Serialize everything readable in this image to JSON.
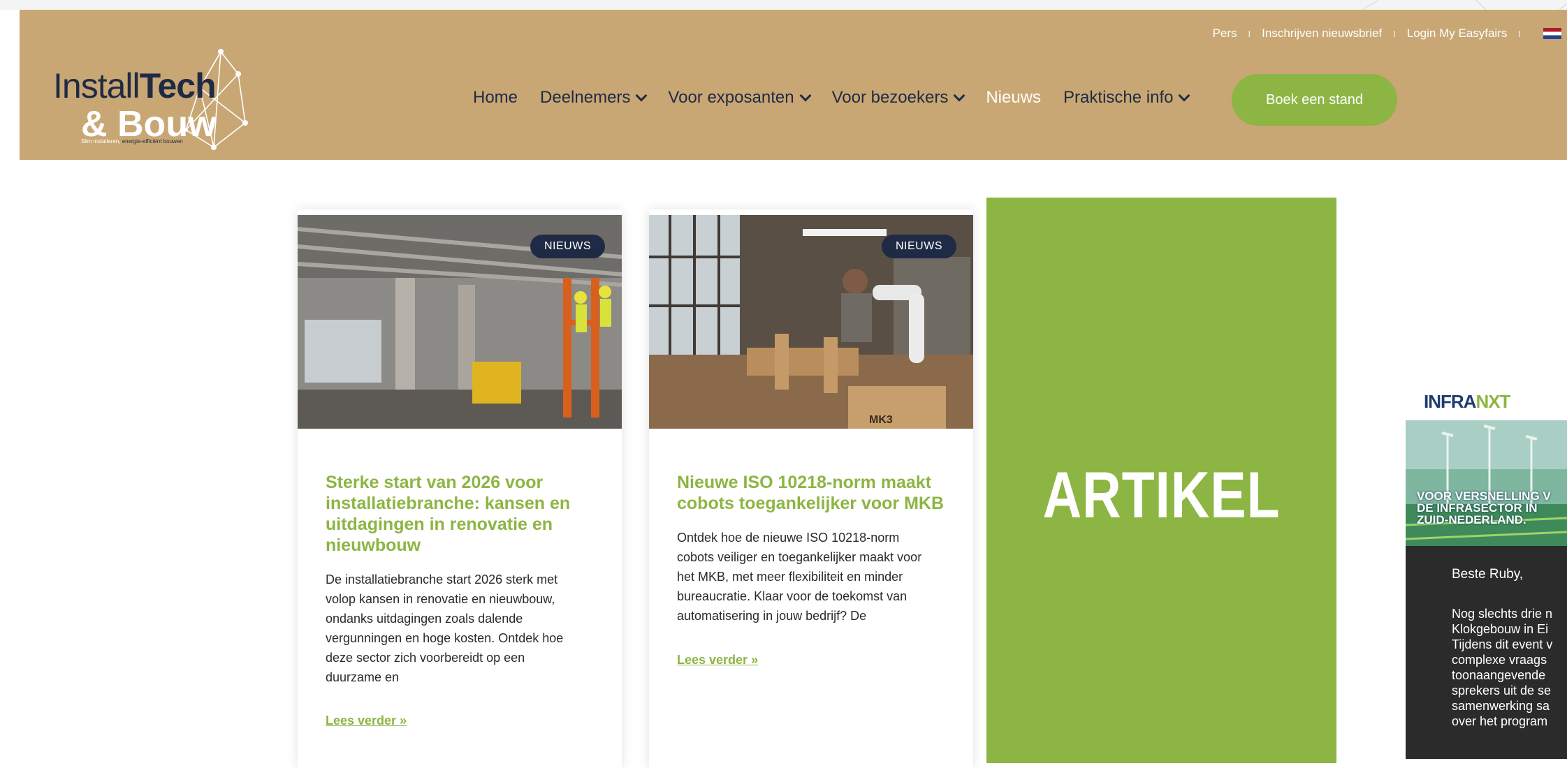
{
  "utility_nav": {
    "items": [
      "Pers",
      "Inschrijven nieuwsbrief",
      "Login My Easyfairs"
    ],
    "separator": "I",
    "language_flag": "nl-flag-icon"
  },
  "logo": {
    "part1": "Install",
    "part2": "Tech",
    "part3": "& Bouw",
    "tagline_a": "Slim installeren,",
    "tagline_b": " energie-efficiënt bouwen"
  },
  "main_nav": {
    "items": [
      {
        "label": "Home",
        "dropdown": false
      },
      {
        "label": "Deelnemers",
        "dropdown": true
      },
      {
        "label": "Voor exposanten",
        "dropdown": true
      },
      {
        "label": "Voor bezoekers",
        "dropdown": true
      },
      {
        "label": "Nieuws",
        "dropdown": false,
        "active": true
      },
      {
        "label": "Praktische info",
        "dropdown": true
      }
    ],
    "cta": "Boek een stand"
  },
  "articles": [
    {
      "badge": "NIEUWS",
      "title": [
        "Sterke start van 2026 voor",
        "installatiebranche: kansen en",
        "uitdagingen in renovatie en",
        "nieuwbouw"
      ],
      "excerpt": [
        "De installatiebranche start 2026 sterk met",
        "volop kansen in renovatie en nieuwbouw,",
        "ondanks uitdagingen zoals dalende",
        "vergunningen en hoge kosten. Ontdek hoe",
        "deze sector zich voorbereidt op een",
        "duurzame en"
      ],
      "read_more": "Lees verder »"
    },
    {
      "badge": "NIEUWS",
      "title": [
        "Nieuwe ISO 10218-norm maakt",
        "cobots toegankelijker voor MKB"
      ],
      "excerpt": [
        "Ontdek hoe de nieuwe ISO 10218-norm",
        "cobots veiliger en toegankelijker maakt voor",
        "het MKB, met meer flexibiliteit en minder",
        "bureaucratie. Klaar voor de toekomst van",
        "automatisering in jouw bedrijf? De"
      ],
      "read_more": "Lees verder »",
      "box_label": "MK3"
    }
  ],
  "artikel_block": {
    "label": "ARTIKEL"
  },
  "advert": {
    "brand_a": "INFRA",
    "brand_b": "NXT",
    "hero_lines": [
      "VOOR VERSNELLING V",
      "DE INFRASECTOR IN",
      "ZUID-NEDERLAND."
    ],
    "greeting": "Beste Ruby,",
    "body_lines": [
      "Nog slechts drie n",
      "Klokgebouw in Ei",
      "Tijdens dit event v",
      "complexe vraags",
      "toonaangevende",
      "sprekers uit de se",
      "samenwerking sa",
      "over het program"
    ]
  },
  "colors": {
    "header_bg": "#c9a774",
    "accent_green": "#8db543",
    "navy": "#1f2a44",
    "ad_dark": "#2b2b2b"
  }
}
